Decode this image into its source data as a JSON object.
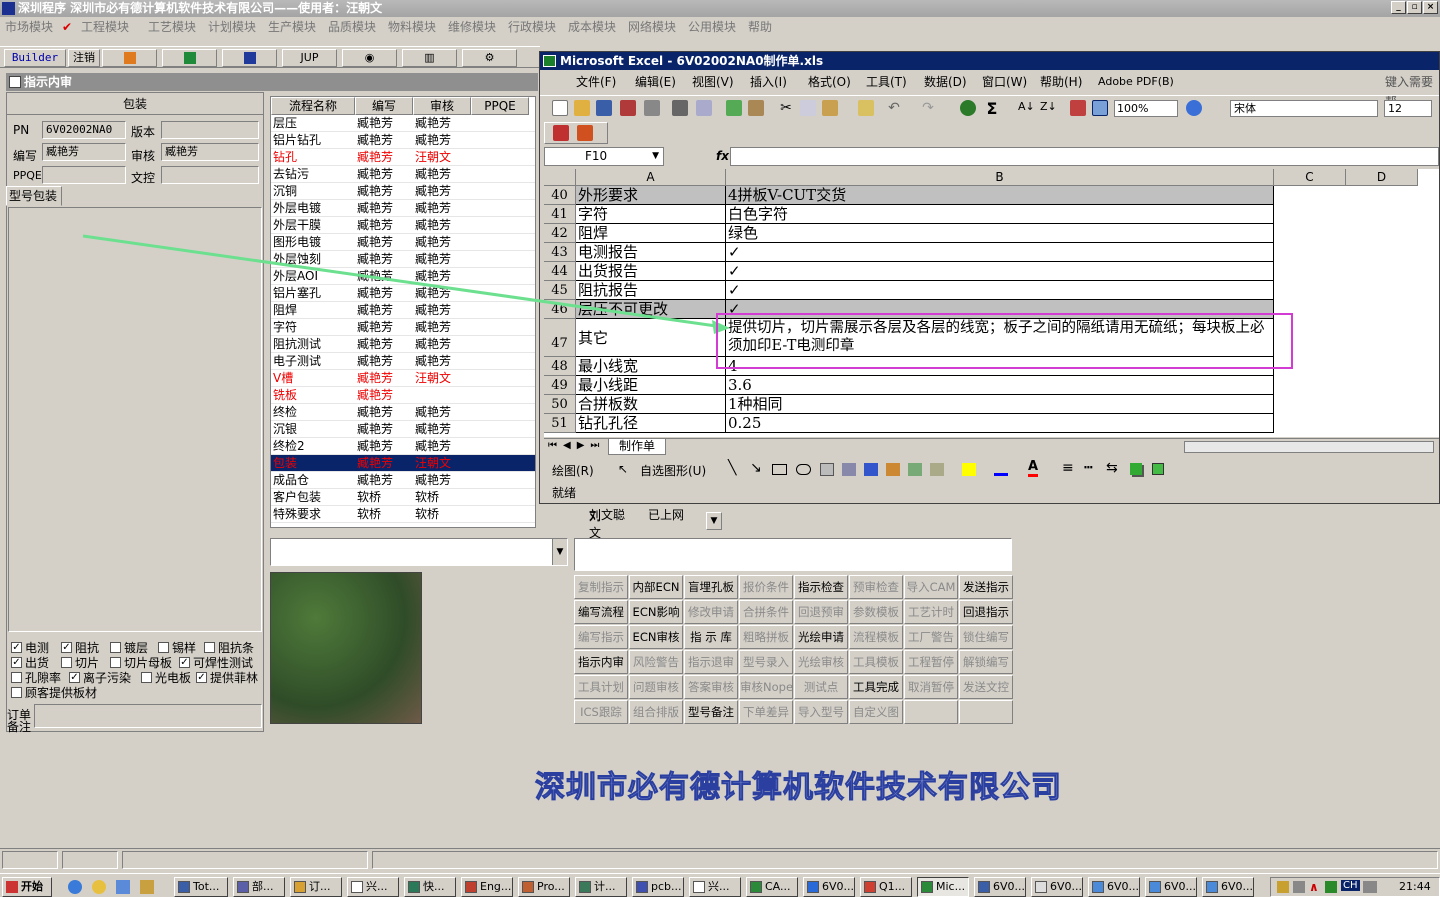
{
  "app": {
    "title": "深圳程序    深圳市必有德计算机软件技术有限公司——使用者：汪朝文"
  },
  "menu": [
    "市场模块",
    "工程模块",
    "工艺模块",
    "计划模块",
    "生产模块",
    "品质模块",
    "物料模块",
    "维修模块",
    "行政模块",
    "成本模块",
    "网络模块",
    "公用模块",
    "帮助"
  ],
  "toolbar": {
    "builder": "Builder",
    "logout": "注销",
    "jup": "JUP"
  },
  "left": {
    "title": "指示内审",
    "pkg_header": "包装",
    "pn_label": "PN",
    "pn_value": "6V02002NA0",
    "version_label": "版本",
    "version_value": "",
    "writer_label": "编写",
    "writer_value": "臧艳芳",
    "reviewer_label": "审核",
    "reviewer_value": "臧艳芳",
    "ppqe_label": "PPQE",
    "ppqe_value": "",
    "doc_label": "文控",
    "doc_value": "",
    "tab": "型号包装",
    "order_label": "订单",
    "remark_label": "备注",
    "checks": [
      {
        "label": "电测",
        "checked": true
      },
      {
        "label": "阻抗",
        "checked": true
      },
      {
        "label": "镀层",
        "checked": false
      },
      {
        "label": "锡样",
        "checked": false
      },
      {
        "label": "阻抗条",
        "checked": false
      },
      {
        "label": "出货",
        "checked": true
      },
      {
        "label": "切片",
        "checked": false
      },
      {
        "label": "切片母板",
        "checked": false
      },
      {
        "label": "可焊性测试",
        "checked": true
      },
      {
        "label": "孔隙率",
        "checked": false
      },
      {
        "label": "离子污染",
        "checked": true
      },
      {
        "label": "光电板",
        "checked": false
      },
      {
        "label": "提供菲林",
        "checked": true
      },
      {
        "label": "顾客提供板材",
        "checked": false
      }
    ]
  },
  "grid": {
    "headers": [
      "流程名称",
      "编写",
      "审核",
      "PPQE"
    ],
    "rows": [
      {
        "name": "层压",
        "w": "臧艳芳",
        "r": "臧艳芳",
        "red": false
      },
      {
        "name": "铝片钻孔",
        "w": "臧艳芳",
        "r": "臧艳芳",
        "red": false
      },
      {
        "name": "钻孔",
        "w": "臧艳芳",
        "r": "汪朝文",
        "red": true
      },
      {
        "name": "去钻污",
        "w": "臧艳芳",
        "r": "臧艳芳",
        "red": false
      },
      {
        "name": "沉铜",
        "w": "臧艳芳",
        "r": "臧艳芳",
        "red": false
      },
      {
        "name": "外层电镀",
        "w": "臧艳芳",
        "r": "臧艳芳",
        "red": false
      },
      {
        "name": "外层干膜",
        "w": "臧艳芳",
        "r": "臧艳芳",
        "red": false
      },
      {
        "name": "图形电镀",
        "w": "臧艳芳",
        "r": "臧艳芳",
        "red": false
      },
      {
        "name": "外层蚀刻",
        "w": "臧艳芳",
        "r": "臧艳芳",
        "red": false
      },
      {
        "name": "外层AOI",
        "w": "臧艳芳",
        "r": "臧艳芳",
        "red": false
      },
      {
        "name": "铝片塞孔",
        "w": "臧艳芳",
        "r": "臧艳芳",
        "red": false
      },
      {
        "name": "阻焊",
        "w": "臧艳芳",
        "r": "臧艳芳",
        "red": false
      },
      {
        "name": "字符",
        "w": "臧艳芳",
        "r": "臧艳芳",
        "red": false
      },
      {
        "name": "阻抗测试",
        "w": "臧艳芳",
        "r": "臧艳芳",
        "red": false
      },
      {
        "name": "电子测试",
        "w": "臧艳芳",
        "r": "臧艳芳",
        "red": false
      },
      {
        "name": "V槽",
        "w": "臧艳芳",
        "r": "汪朝文",
        "red": true
      },
      {
        "name": "铣板",
        "w": "臧艳芳",
        "r": "",
        "red": true
      },
      {
        "name": "终检",
        "w": "臧艳芳",
        "r": "臧艳芳",
        "red": false
      },
      {
        "name": "沉银",
        "w": "臧艳芳",
        "r": "臧艳芳",
        "red": false
      },
      {
        "name": "终检2",
        "w": "臧艳芳",
        "r": "臧艳芳",
        "red": false
      },
      {
        "name": "包装",
        "w": "臧艳芳",
        "r": "汪朝文",
        "red": true,
        "selected": true
      },
      {
        "name": "成品仓",
        "w": "臧艳芳",
        "r": "臧艳芳",
        "red": false
      },
      {
        "name": "客户包装",
        "w": "软桥",
        "r": "软桥",
        "red": false
      },
      {
        "name": "特殊要求",
        "w": "软桥",
        "r": "软桥",
        "red": false
      }
    ],
    "footer_left": "刘文聪",
    "footer_right": "已上网"
  },
  "buttons": [
    [
      {
        "l": "复制指示",
        "d": true
      },
      {
        "l": "内部ECN",
        "d": false
      },
      {
        "l": "盲埋孔板",
        "d": false
      },
      {
        "l": "报价条件",
        "d": true
      },
      {
        "l": "指示检查",
        "d": false
      },
      {
        "l": "预审检查",
        "d": true
      },
      {
        "l": "导入CAM",
        "d": true
      },
      {
        "l": "发送指示",
        "d": false
      }
    ],
    [
      {
        "l": "编写流程",
        "d": false
      },
      {
        "l": "ECN影响",
        "d": false
      },
      {
        "l": "修改申请",
        "d": true
      },
      {
        "l": "合拼条件",
        "d": true
      },
      {
        "l": "回退预审",
        "d": true
      },
      {
        "l": "参数模板",
        "d": true
      },
      {
        "l": "工艺计时",
        "d": true
      },
      {
        "l": "回退指示",
        "d": false
      }
    ],
    [
      {
        "l": "编写指示",
        "d": true
      },
      {
        "l": "ECN审核",
        "d": false
      },
      {
        "l": "指 示 库",
        "d": false
      },
      {
        "l": "粗略拼板",
        "d": true
      },
      {
        "l": "光绘申请",
        "d": false
      },
      {
        "l": "流程模板",
        "d": true
      },
      {
        "l": "工厂警告",
        "d": true
      },
      {
        "l": "锁住编写",
        "d": true
      }
    ],
    [
      {
        "l": "指示内审",
        "d": false
      },
      {
        "l": "风险警告",
        "d": true
      },
      {
        "l": "指示退审",
        "d": true
      },
      {
        "l": "型号录入",
        "d": true
      },
      {
        "l": "光绘审核",
        "d": true
      },
      {
        "l": "工具模板",
        "d": true
      },
      {
        "l": "工程暂停",
        "d": true
      },
      {
        "l": "解锁编写",
        "d": true
      }
    ],
    [
      {
        "l": "工具计划",
        "d": true
      },
      {
        "l": "问题审核",
        "d": true
      },
      {
        "l": "答案审核",
        "d": true
      },
      {
        "l": "审核Nope",
        "d": true
      },
      {
        "l": "测试点",
        "d": true
      },
      {
        "l": "工具完成",
        "d": false
      },
      {
        "l": "取消暂停",
        "d": true
      },
      {
        "l": "发送文控",
        "d": true
      }
    ],
    [
      {
        "l": "ICS跟踪",
        "d": true
      },
      {
        "l": "组合排版",
        "d": true
      },
      {
        "l": "型号备注",
        "d": false
      },
      {
        "l": "下单差异",
        "d": true
      },
      {
        "l": "导入型号",
        "d": true
      },
      {
        "l": "自定义图",
        "d": true
      },
      {
        "l": "",
        "d": true
      },
      {
        "l": "",
        "d": true
      }
    ]
  ],
  "excel": {
    "title": "Microsoft Excel - 6V02002NA0制作单.xls",
    "menu": [
      "文件(F)",
      "编辑(E)",
      "视图(V)",
      "插入(I)",
      "格式(O)",
      "工具(T)",
      "数据(D)",
      "窗口(W)",
      "帮助(H)",
      "Adobe PDF(B)"
    ],
    "help_placeholder": "键入需要帮",
    "zoom": "100%",
    "font": "宋体",
    "size": "12",
    "namebox": "F10",
    "fx": "fx",
    "cols": [
      "A",
      "B",
      "C",
      "D"
    ],
    "rows": [
      {
        "n": "40",
        "a": "外形要求",
        "b": "4拼板V-CUT交货",
        "grey": true
      },
      {
        "n": "41",
        "a": "字符",
        "b": "白色字符",
        "grey": false
      },
      {
        "n": "42",
        "a": "阻焊",
        "b": "绿色",
        "grey": false
      },
      {
        "n": "43",
        "a": "电测报告",
        "b": "✓",
        "grey": false
      },
      {
        "n": "44",
        "a": "出货报告",
        "b": "✓",
        "grey": false
      },
      {
        "n": "45",
        "a": "阻抗报告",
        "b": "✓",
        "grey": false
      },
      {
        "n": "46",
        "a": "层压不可更改",
        "b": "✓",
        "grey": true
      },
      {
        "n": "47",
        "a": "其它",
        "b": "提供切片，切片需展示各层及各层的线宽；板子之间的隔纸请用无硫纸；每块板上必须加印E-T电测印章",
        "grey": false,
        "tall": true
      },
      {
        "n": "48",
        "a": "最小线宽",
        "b": "4",
        "grey": false
      },
      {
        "n": "49",
        "a": "最小线距",
        "b": "3.6",
        "grey": false
      },
      {
        "n": "50",
        "a": "合拼板数",
        "b": "1种相同",
        "grey": false
      },
      {
        "n": "51",
        "a": "钻孔孔径",
        "b": "0.25",
        "grey": false
      }
    ],
    "sheet_tab": "制作单",
    "draw": "绘图(R)",
    "autoshape": "自选图形(U)",
    "status": "就绪"
  },
  "company": "深圳市必有德计算机软件技术有限公司",
  "taskbar": {
    "start": "开始",
    "items": [
      "Tot...",
      "部...",
      "订...",
      "兴...",
      "快...",
      "Eng...",
      "Pro...",
      "计...",
      "pcb...",
      "兴...",
      "CA...",
      "6V0...",
      "Q1...",
      "Mic...",
      "6V0...",
      "6V0...",
      "6V0...",
      "6V0...",
      "6V0..."
    ],
    "active_index": 13,
    "clock": "21:44",
    "ime": "CH"
  },
  "colors": {
    "title_blue": "#0a246a",
    "annotation": "#d23cd2",
    "arrow": "#6de08f"
  }
}
